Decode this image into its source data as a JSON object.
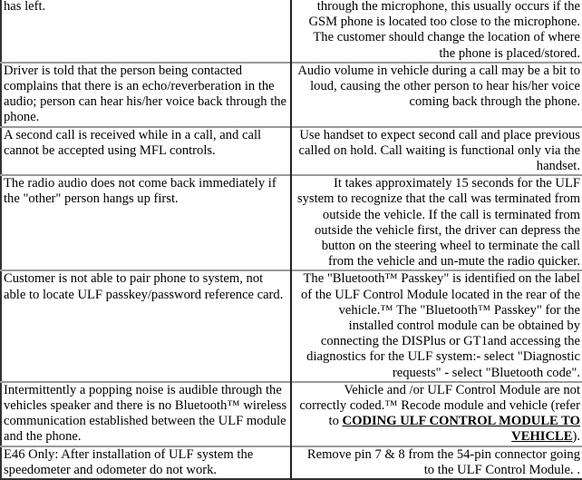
{
  "table": {
    "rows": [
      {
        "symptom": "has left.",
        "remedy": "through the microphone, this usually occurs if the GSM phone is located too close to the microphone. The customer should change the location of where the phone is placed/stored."
      },
      {
        "symptom": "Driver is told that the person being contacted complains that there is an echo/reverberation in the audio; person can hear his/her voice back through the phone.",
        "remedy": "Audio volume in vehicle during a call may be a bit to loud, causing the other person to hear his/her voice coming back through the phone."
      },
      {
        "symptom": "A second call is received while in a call, and call cannot be accepted using MFL controls.",
        "remedy": "Use handset to expect second call and place previous called on hold. Call waiting is functional only via the handset."
      },
      {
        "symptom": "The radio audio does not come back immediately if the \"other\" person hangs up first.",
        "remedy": "It takes approximately 15 seconds for the ULF system to recognize that the call was terminated from outside the vehicle. If the call is terminated from outside the vehicle first, the driver can depress the button on the steering wheel to terminate the call from the vehicle and un-mute the radio quicker."
      },
      {
        "symptom": "Customer is not able to pair phone to system, not able to locate ULF passkey/password reference card.",
        "remedy": "The \"Bluetooth™ Passkey\" is identified on the label of the ULF Control Module located in the rear of the vehicle.™ The \"Bluetooth™ Passkey\" for the installed control module can be obtained by connecting the DISPlus or GT1and accessing the diagnostics for the ULF system:- select \"Diagnostic requests\" - select \"Bluetooth code\"."
      },
      {
        "symptom": "Intermittently a popping noise is audible through the vehicles speaker and there is no Bluetooth™ wireless communication established between the ULF module and the phone.",
        "remedy_prefix": "Vehicle and /or ULF Control Module are not correctly coded.™ Recode module and vehicle (refer to ",
        "remedy_link": "CODING ULF CONTROL MODULE TO VEHICLE",
        "remedy_suffix": ")."
      },
      {
        "symptom": "E46 Only: After installation of ULF system the speedometer and odometer do not work.",
        "remedy": "Remove pin 7 & 8 from the 54-pin connector going to the ULF Control Module. ."
      }
    ]
  }
}
